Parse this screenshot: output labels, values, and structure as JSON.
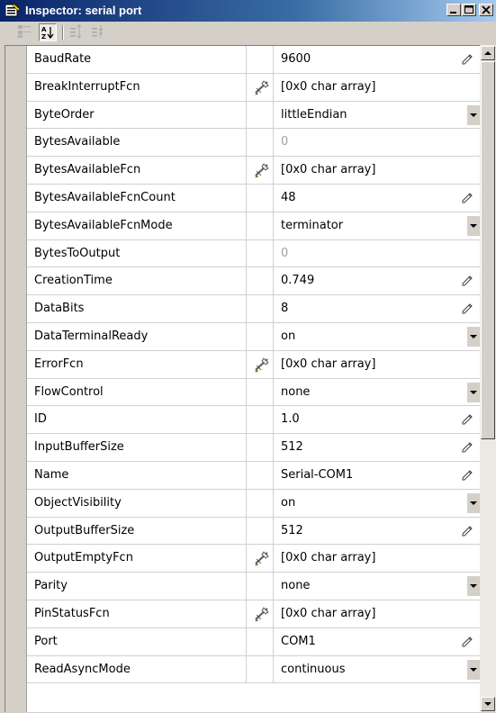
{
  "window": {
    "title": "Inspector: serial port",
    "controls": [
      "minimize",
      "maximize",
      "close"
    ]
  },
  "toolbar": {
    "buttons": [
      {
        "name": "categorized-icon",
        "pressed": false
      },
      {
        "name": "sort-alphabetical-icon",
        "pressed": true
      },
      {
        "name": "expand-all-icon",
        "pressed": false
      },
      {
        "name": "collapse-all-icon",
        "pressed": false
      }
    ]
  },
  "properties": [
    {
      "name": "BaudRate",
      "value": "9600",
      "editor": "pencil"
    },
    {
      "name": "BreakInterruptFcn",
      "value": "[0x0  char array]",
      "editor": "callback"
    },
    {
      "name": "ByteOrder",
      "value": "littleEndian",
      "editor": "dropdown"
    },
    {
      "name": "BytesAvailable",
      "value": "0",
      "editor": "readonly"
    },
    {
      "name": "BytesAvailableFcn",
      "value": "[0x0  char array]",
      "editor": "callback"
    },
    {
      "name": "BytesAvailableFcnCount",
      "value": "48",
      "editor": "pencil"
    },
    {
      "name": "BytesAvailableFcnMode",
      "value": "terminator",
      "editor": "dropdown"
    },
    {
      "name": "BytesToOutput",
      "value": "0",
      "editor": "readonly"
    },
    {
      "name": "CreationTime",
      "value": "0.749",
      "editor": "pencil"
    },
    {
      "name": "DataBits",
      "value": "8",
      "editor": "pencil"
    },
    {
      "name": "DataTerminalReady",
      "value": "on",
      "editor": "dropdown"
    },
    {
      "name": "ErrorFcn",
      "value": "[0x0  char array]",
      "editor": "callback"
    },
    {
      "name": "FlowControl",
      "value": "none",
      "editor": "dropdown"
    },
    {
      "name": "ID",
      "value": "1.0",
      "editor": "pencil"
    },
    {
      "name": "InputBufferSize",
      "value": "512",
      "editor": "pencil"
    },
    {
      "name": "Name",
      "value": "Serial-COM1",
      "editor": "pencil"
    },
    {
      "name": "ObjectVisibility",
      "value": "on",
      "editor": "dropdown"
    },
    {
      "name": "OutputBufferSize",
      "value": "512",
      "editor": "pencil"
    },
    {
      "name": "OutputEmptyFcn",
      "value": "[0x0  char array]",
      "editor": "callback"
    },
    {
      "name": "Parity",
      "value": "none",
      "editor": "dropdown"
    },
    {
      "name": "PinStatusFcn",
      "value": "[0x0  char array]",
      "editor": "callback"
    },
    {
      "name": "Port",
      "value": "COM1",
      "editor": "pencil"
    },
    {
      "name": "ReadAsyncMode",
      "value": "continuous",
      "editor": "dropdown"
    }
  ],
  "colors": {
    "titlebar_start": "#0a246a",
    "titlebar_end": "#a6caf0",
    "chrome": "#d4d0c8",
    "readonly_text": "#a0a0a0"
  }
}
